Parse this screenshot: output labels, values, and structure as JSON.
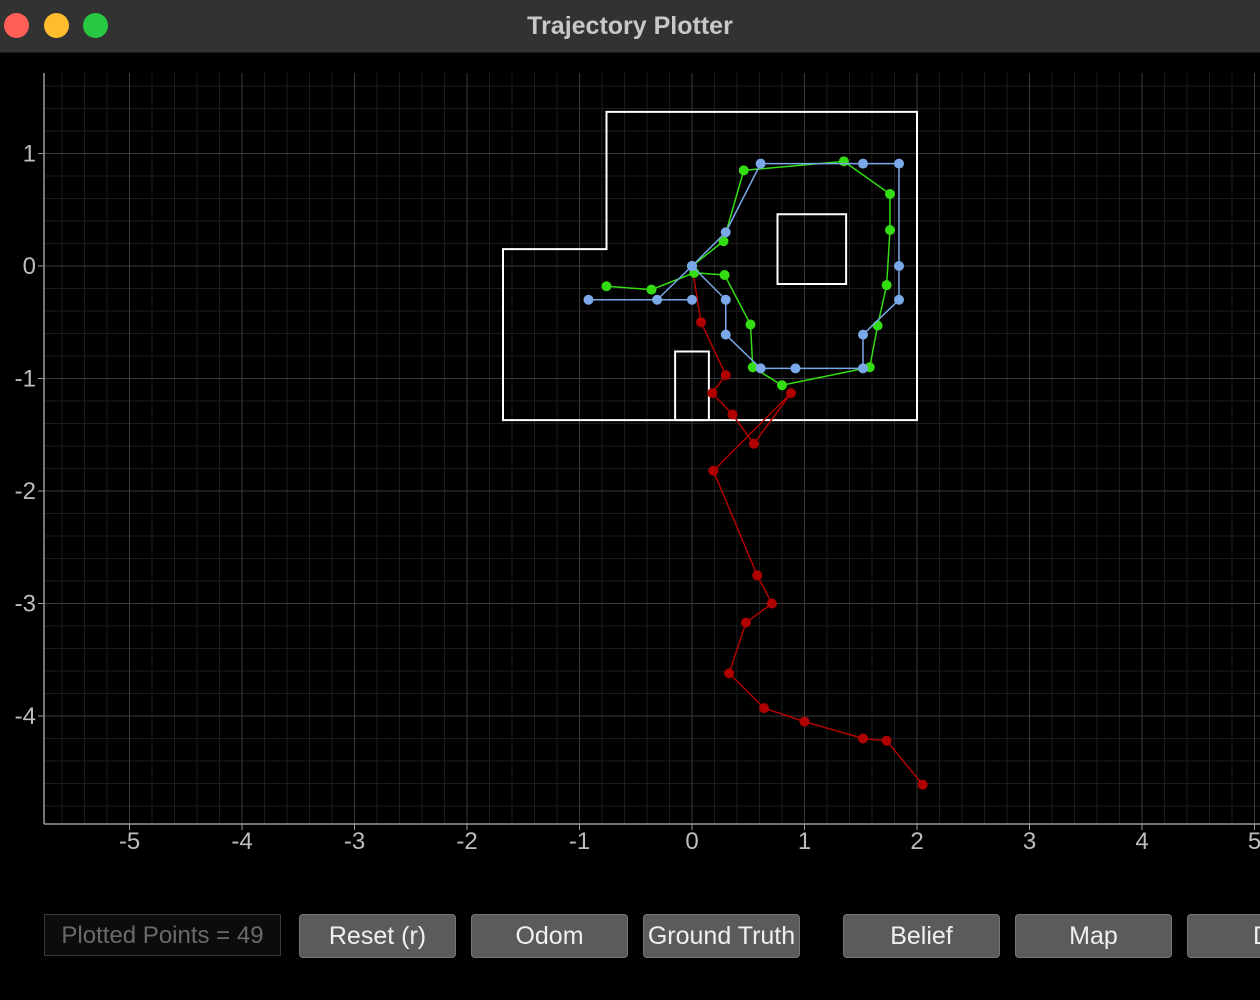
{
  "window": {
    "title": "Trajectory Plotter"
  },
  "toolbar": {
    "counter_text": "Plotted Points = 49",
    "buttons": [
      "Reset (r)",
      "Odom",
      "Ground Truth",
      "Belief",
      "Map",
      "Di"
    ]
  },
  "chart_data": {
    "type": "line",
    "title": "",
    "xlabel": "",
    "ylabel": "",
    "xlim": [
      -5.8,
      5.2
    ],
    "ylim": [
      -4.9,
      1.7
    ],
    "x_ticks": [
      -5,
      -4,
      -3,
      -2,
      -1,
      0,
      1,
      2,
      3,
      4,
      5
    ],
    "y_ticks": [
      1,
      0,
      -1,
      -2,
      -3,
      -4
    ],
    "grid": true,
    "colors": {
      "background": "#000000",
      "map": "#ffffff",
      "odom": "#b00000",
      "ground_truth": "#33dd11",
      "belief": "#7aa8e8"
    },
    "map_polygons": [
      [
        [
          -1.68,
          -1.37
        ],
        [
          2.0,
          -1.37
        ],
        [
          2.0,
          1.37
        ],
        [
          -0.76,
          1.37
        ],
        [
          -0.76,
          0.15
        ],
        [
          -1.68,
          0.15
        ]
      ],
      [
        [
          0.76,
          -0.16
        ],
        [
          1.37,
          -0.16
        ],
        [
          1.37,
          0.46
        ],
        [
          0.76,
          0.46
        ]
      ],
      [
        [
          -0.15,
          -1.37
        ],
        [
          -0.15,
          -0.76
        ],
        [
          0.15,
          -0.76
        ],
        [
          0.15,
          -1.37
        ]
      ]
    ],
    "series": [
      {
        "x": [
          0.0,
          0.08,
          0.3,
          0.18,
          0.36,
          0.55,
          0.88,
          0.19,
          0.58,
          0.71,
          0.48,
          0.33,
          0.64,
          1.0,
          1.52,
          1.73,
          2.05
        ],
        "y": [
          0.0,
          -0.5,
          -0.97,
          -1.13,
          -1.32,
          -1.58,
          -1.13,
          -1.82,
          -2.75,
          -3.0,
          -3.17,
          -3.62,
          -3.93,
          -4.05,
          -4.2,
          -4.22,
          -4.61
        ]
      },
      {
        "x": [
          0.0,
          0.28,
          0.46,
          1.35,
          1.76,
          1.76,
          1.73,
          1.65,
          1.58,
          0.8,
          0.54,
          0.52,
          0.29,
          0.02,
          -0.36,
          -0.76
        ],
        "y": [
          0.0,
          0.22,
          0.85,
          0.93,
          0.64,
          0.32,
          -0.17,
          -0.53,
          -0.9,
          -1.06,
          -0.9,
          -0.52,
          -0.08,
          -0.06,
          -0.21,
          -0.18
        ]
      },
      {
        "x": [
          0.0,
          0.3,
          0.61,
          1.52,
          1.84,
          1.84,
          1.84,
          1.52,
          1.52,
          0.92,
          0.61,
          0.3,
          0.3,
          0.0,
          -0.31,
          -0.92,
          0.0
        ],
        "y": [
          0.0,
          0.3,
          0.91,
          0.91,
          0.91,
          0.0,
          -0.3,
          -0.61,
          -0.91,
          -0.91,
          -0.91,
          -0.61,
          -0.3,
          0.0,
          -0.3,
          -0.3,
          -0.3
        ]
      }
    ]
  }
}
